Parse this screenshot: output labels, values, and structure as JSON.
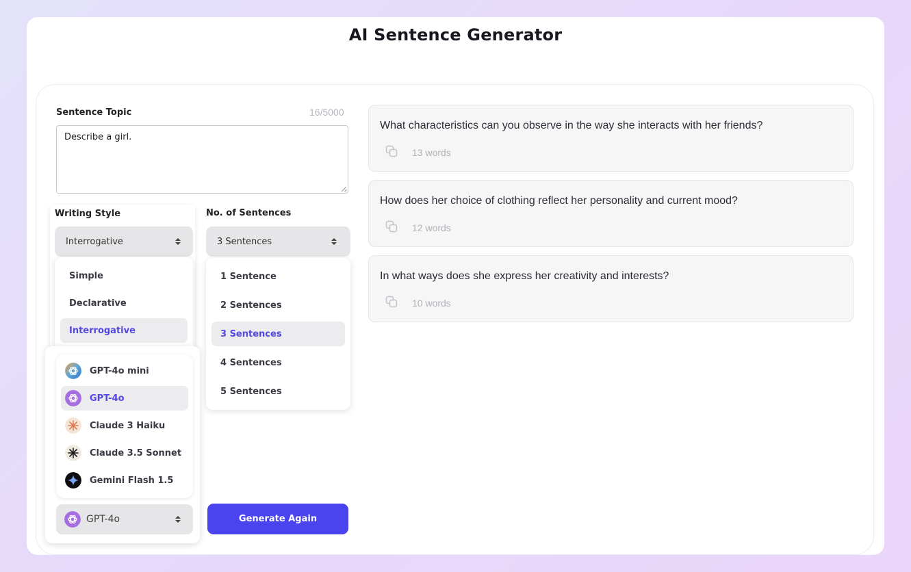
{
  "app": {
    "title": "AI Sentence Generator"
  },
  "topic": {
    "label": "Sentence Topic",
    "char_count": "16/5000",
    "value": "Describe a girl."
  },
  "writing_style": {
    "label": "Writing Style",
    "selected": "Interrogative",
    "options": [
      "Simple",
      "Declarative",
      "Interrogative"
    ]
  },
  "sentences": {
    "label": "No. of Sentences",
    "selected": "3 Sentences",
    "options": [
      "1 Sentence",
      "2 Sentences",
      "3 Sentences",
      "4 Sentences",
      "5 Sentences"
    ]
  },
  "model": {
    "selected": "GPT-4o",
    "options": [
      {
        "name": "GPT-4o mini",
        "icon": "openai-icon"
      },
      {
        "name": "GPT-4o",
        "icon": "openai-icon"
      },
      {
        "name": "Claude 3 Haiku",
        "icon": "anthropic-icon"
      },
      {
        "name": "Claude 3.5 Sonnet",
        "icon": "anthropic-icon"
      },
      {
        "name": "Gemini Flash 1.5",
        "icon": "gemini-icon"
      }
    ]
  },
  "generate_button": "Generate Again",
  "results": [
    {
      "text": "What characteristics can you observe in the way she interacts with her friends?",
      "words": "13 words"
    },
    {
      "text": "How does her choice of clothing reflect her personality and current mood?",
      "words": "12 words"
    },
    {
      "text": "In what ways does she express her creativity and interests?",
      "words": "10 words"
    }
  ],
  "colors": {
    "accent": "#4a44ee",
    "selected_text": "#5347e0",
    "background": "#e6dcfb"
  }
}
